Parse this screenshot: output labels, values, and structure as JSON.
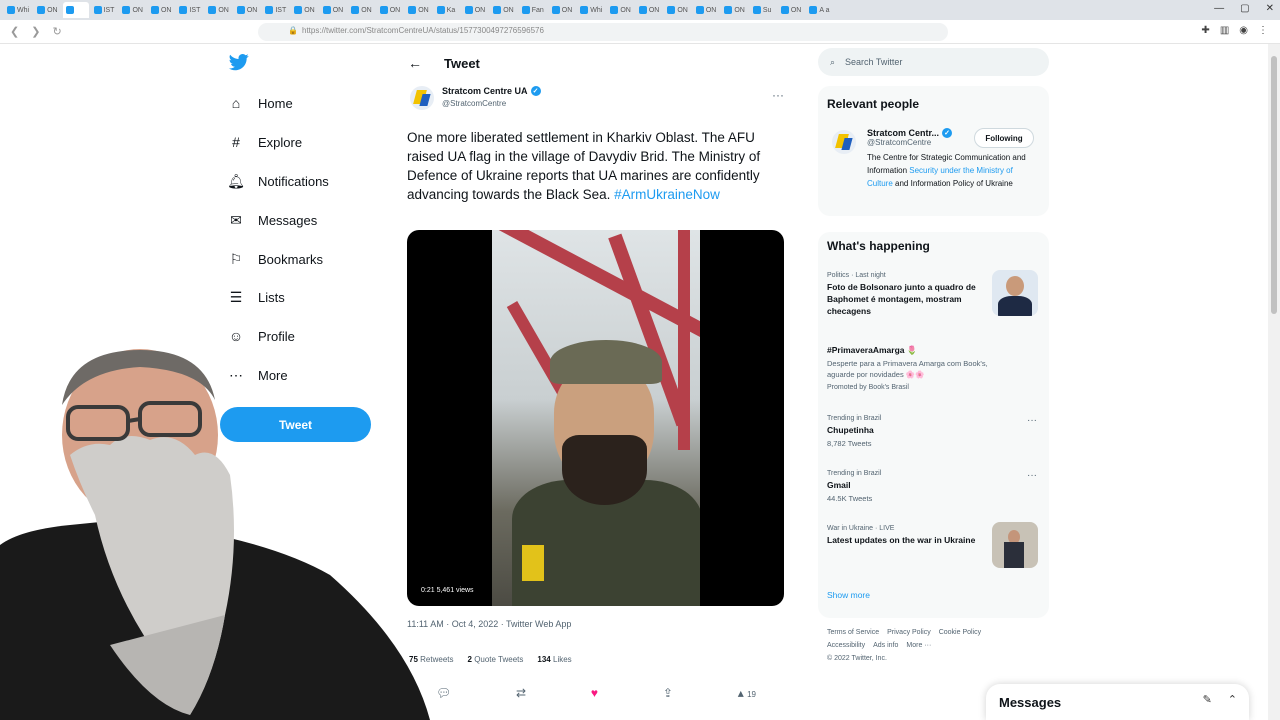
{
  "browser": {
    "url": "https://twitter.com/StratcomCentreUA/status/1577300497276596576",
    "tabs": [
      "Whi",
      "ON",
      "",
      "IST",
      "ON",
      "ON",
      "IST",
      "ON",
      "ON",
      "IST",
      "ON",
      "ON",
      "ON",
      "ON",
      "ON",
      "Ka",
      "ON",
      "ON",
      "Fan",
      "ON",
      "Whi",
      "ON",
      "ON",
      "ON",
      "ON",
      "ON",
      "Su",
      "ON",
      "A a"
    ]
  },
  "nav": {
    "items": [
      {
        "label": "Home",
        "icon": "home-icon"
      },
      {
        "label": "Explore",
        "icon": "hashtag-icon"
      },
      {
        "label": "Notifications",
        "icon": "bell-icon"
      },
      {
        "label": "Messages",
        "icon": "envelope-icon"
      },
      {
        "label": "Bookmarks",
        "icon": "bookmark-icon"
      },
      {
        "label": "Lists",
        "icon": "list-icon"
      },
      {
        "label": "Profile",
        "icon": "person-icon"
      },
      {
        "label": "More",
        "icon": "more-circle-icon"
      }
    ],
    "tweet_button": "Tweet"
  },
  "tweet": {
    "header": "Tweet",
    "author_name": "Stratcom Centre UA",
    "author_handle": "@StratcomCentre",
    "text": "One more liberated settlement in Kharkiv Oblast. The AFU raised UA flag in the village of Davydiv Brid. The Ministry of Defence of Ukraine reports that UA marines are confidently advancing towards the Black Sea. ",
    "hashtag": "#ArmUkraineNow",
    "video_info": "0:21  5,461 views",
    "timestamp": "11:11 AM · Oct 4, 2022 · Twitter Web App",
    "retweets_count": "75",
    "retweets_label": "Retweets",
    "quotes_count": "2",
    "quotes_label": "Quote Tweets",
    "likes_count": "134",
    "likes_label": "Likes",
    "share_count": "19"
  },
  "right": {
    "search_placeholder": "Search Twitter",
    "relevant_title": "Relevant people",
    "person_name": "Stratcom Centr...",
    "person_handle": "@StratcomCentre",
    "person_bio_1": "The Centre for Strategic Communication and Information ",
    "person_bio_link": "Security under the Ministry of Culture",
    "person_bio_2": " and Information Policy of Ukraine",
    "follow_label": "Following",
    "happening_title": "What's happening",
    "trends": [
      {
        "ctx": "Politics · Last night",
        "title": "Foto de Bolsonaro junto a quadro de Baphomet é montagem, mostram checagens",
        "sub": ""
      },
      {
        "ctx": "",
        "title": "#PrimaveraAmarga 🌷",
        "sub": "Desperte para a Primavera Amarga com Book's, aguarde por novidades 🌸🌸"
      },
      {
        "ctx": "",
        "title": "",
        "sub": "Promoted by Book's Brasil"
      },
      {
        "ctx": "Trending in Brazil",
        "title": "Chupetinha",
        "sub": "8,782 Tweets"
      },
      {
        "ctx": "Trending in Brazil",
        "title": "Gmail",
        "sub": "44.5K Tweets"
      },
      {
        "ctx": "War in Ukraine · LIVE",
        "title": "Latest updates on the war in Ukraine",
        "sub": ""
      }
    ],
    "show_more": "Show more",
    "footer_1": [
      "Terms of Service",
      "Privacy Policy",
      "Cookie Policy"
    ],
    "footer_2": [
      "Accessibility",
      "Ads info",
      "More ···"
    ],
    "footer_3": "© 2022 Twitter, Inc."
  },
  "messages_bar": {
    "title": "Messages"
  },
  "colors": {
    "accent": "#1d9bf0",
    "like": "#f91880"
  }
}
